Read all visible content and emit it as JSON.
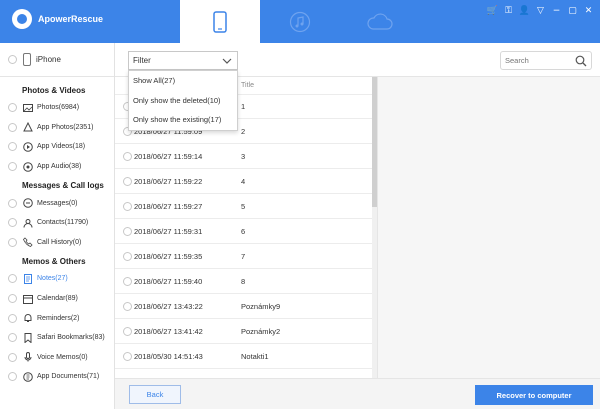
{
  "app": {
    "name": "ApowerRescue",
    "accent": "#3c84e8"
  },
  "tabs": [
    {
      "icon": "phone-icon",
      "active": true
    },
    {
      "icon": "music-icon",
      "active": false
    },
    {
      "icon": "cloud-icon",
      "active": false
    }
  ],
  "window_controls": [
    "cart-icon",
    "key-icon",
    "user-icon",
    "shirt-icon",
    "minimize-icon",
    "maximize-icon",
    "close-icon"
  ],
  "sidebar": {
    "device": "iPhone",
    "sections": [
      {
        "title": "Photos & Videos",
        "items": [
          {
            "label": "Photos(6984)",
            "icon": "photo-icon"
          },
          {
            "label": "App Photos(2351)",
            "icon": "app-photo-icon"
          },
          {
            "label": "App Videos(18)",
            "icon": "play-icon"
          },
          {
            "label": "App Audio(38)",
            "icon": "audio-icon"
          }
        ]
      },
      {
        "title": "Messages & Call logs",
        "items": [
          {
            "label": "Messages(0)",
            "icon": "message-icon"
          },
          {
            "label": "Contacts(11790)",
            "icon": "contact-icon"
          },
          {
            "label": "Call History(0)",
            "icon": "phone-call-icon"
          }
        ]
      },
      {
        "title": "Memos & Others",
        "items": [
          {
            "label": "Notes(27)",
            "icon": "notes-icon",
            "active": true
          },
          {
            "label": "Calendar(89)",
            "icon": "calendar-icon"
          },
          {
            "label": "Reminders(2)",
            "icon": "bell-icon"
          },
          {
            "label": "Safari Bookmarks(83)",
            "icon": "bookmark-icon"
          },
          {
            "label": "Voice Memos(0)",
            "icon": "mic-icon"
          },
          {
            "label": "App Documents(71)",
            "icon": "document-icon"
          }
        ]
      }
    ]
  },
  "toolbar": {
    "filter_label": "Filter",
    "search_placeholder": "Search"
  },
  "filter_options": [
    "Show All(27)",
    "Only show the deleted(10)",
    "Only show the existing(17)"
  ],
  "table": {
    "title_header": "Title",
    "rows": [
      {
        "time": "",
        "title": "1"
      },
      {
        "time": "2018/06/27 11:59:09",
        "title": "2"
      },
      {
        "time": "2018/06/27 11:59:14",
        "title": "3"
      },
      {
        "time": "2018/06/27 11:59:22",
        "title": "4"
      },
      {
        "time": "2018/06/27 11:59:27",
        "title": "5"
      },
      {
        "time": "2018/06/27 11:59:31",
        "title": "6"
      },
      {
        "time": "2018/06/27 11:59:35",
        "title": "7"
      },
      {
        "time": "2018/06/27 11:59:40",
        "title": "8"
      },
      {
        "time": "2018/06/27 13:43:22",
        "title": "Poznámky9"
      },
      {
        "time": "2018/06/27 13:41:42",
        "title": "Poznámky2"
      },
      {
        "time": "2018/05/30 14:51:43",
        "title": "Notakti1"
      }
    ]
  },
  "buttons": {
    "back": "Back",
    "recover": "Recover to computer"
  }
}
